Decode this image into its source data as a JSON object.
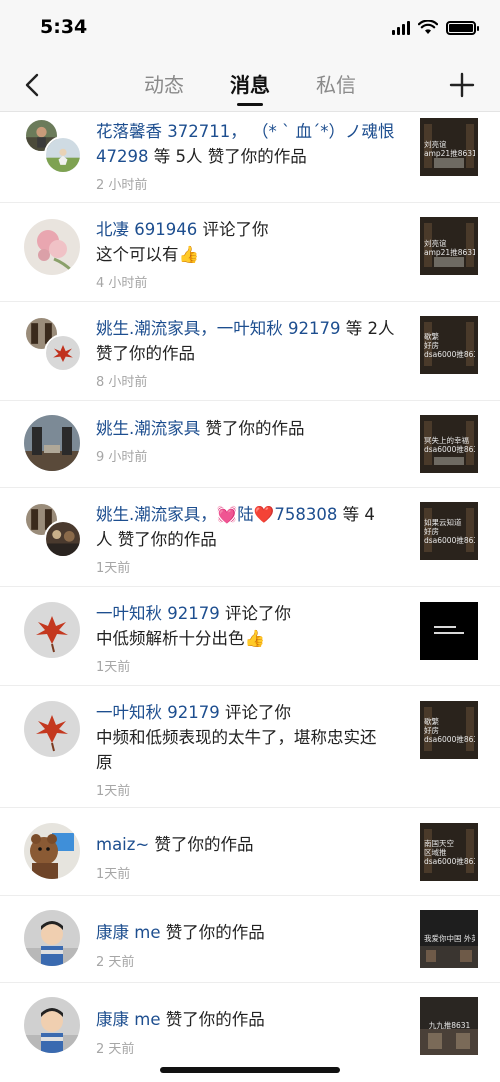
{
  "status_bar": {
    "time": "5:34"
  },
  "nav": {
    "tabs": [
      {
        "label": "动态",
        "active": false
      },
      {
        "label": "消息",
        "active": true
      },
      {
        "label": "私信",
        "active": false
      }
    ],
    "back_icon": "chevron-left-icon",
    "add_icon": "plus-icon"
  },
  "colors": {
    "name_link": "#1d4e8f",
    "time_text": "#a6a6a6",
    "active_tab": "#111111"
  },
  "notifications": [
    {
      "line1_names": "花落馨香 372711， （* ` 血´*）ノ魂恨",
      "line2_names": "47298",
      "line2_rest": " 等 5人 赞了你的作品",
      "time": "2 小时前",
      "thumb": [
        "刘亮谊",
        "amp21推8631"
      ]
    },
    {
      "names": "北凄 691946",
      "action": " 评论了你",
      "comment": "这个可以有",
      "comment_emoji": "👍",
      "time": "4 小时前",
      "thumb": [
        "刘亮谊",
        "amp21推8631"
      ]
    },
    {
      "names": "姚生.潮流家具，一叶知秋 92179",
      "names_rest": " 等 2人",
      "line2": "赞了你的作品",
      "time": "8 小时前",
      "thumb": [
        "歇繁",
        "好房",
        "dsa6000推8631"
      ]
    },
    {
      "names": "姚生.潮流家具",
      "action": " 赞了你的作品",
      "time": "9 小时前",
      "thumb": [
        "冥失上的幸福",
        "dsa6000推8631"
      ]
    },
    {
      "line1_names_a": "姚生.潮流家具，",
      "heart_pink": "💓",
      "line1_names_b": "陆",
      "heart_red": "❤️",
      "line1_names_c": "758308",
      "line1_rest": " 等 4",
      "line2": "人 赞了你的作品",
      "time": "1天前",
      "thumb": [
        "如果云知道",
        "好房",
        "dsa6000推8631"
      ]
    },
    {
      "names": "一叶知秋 92179",
      "action": " 评论了你",
      "comment": "中低频解析十分出色",
      "comment_emoji": "👍",
      "time": "1天前",
      "thumb": []
    },
    {
      "names": "一叶知秋 92179",
      "action": " 评论了你",
      "comment_line1": "中频和低频表现的太牛了，堪称忠实还",
      "comment_line2": "原",
      "time": "1天前",
      "thumb": [
        "歇繁",
        "好房",
        "dsa6000推8631"
      ]
    },
    {
      "names": "maiz~",
      "action": " 赞了你的作品",
      "time": "1天前",
      "thumb": [
        "南国天空",
        "区域推",
        "dsa6000推8631"
      ]
    },
    {
      "names": "康康 me",
      "action": " 赞了你的作品",
      "time": "2 天前",
      "thumb": [
        "我爱你中国 外英语频"
      ]
    },
    {
      "names": "康康 me",
      "action": " 赞了你的作品",
      "time": "2 天前",
      "thumb": [
        "九九推8631"
      ]
    }
  ]
}
